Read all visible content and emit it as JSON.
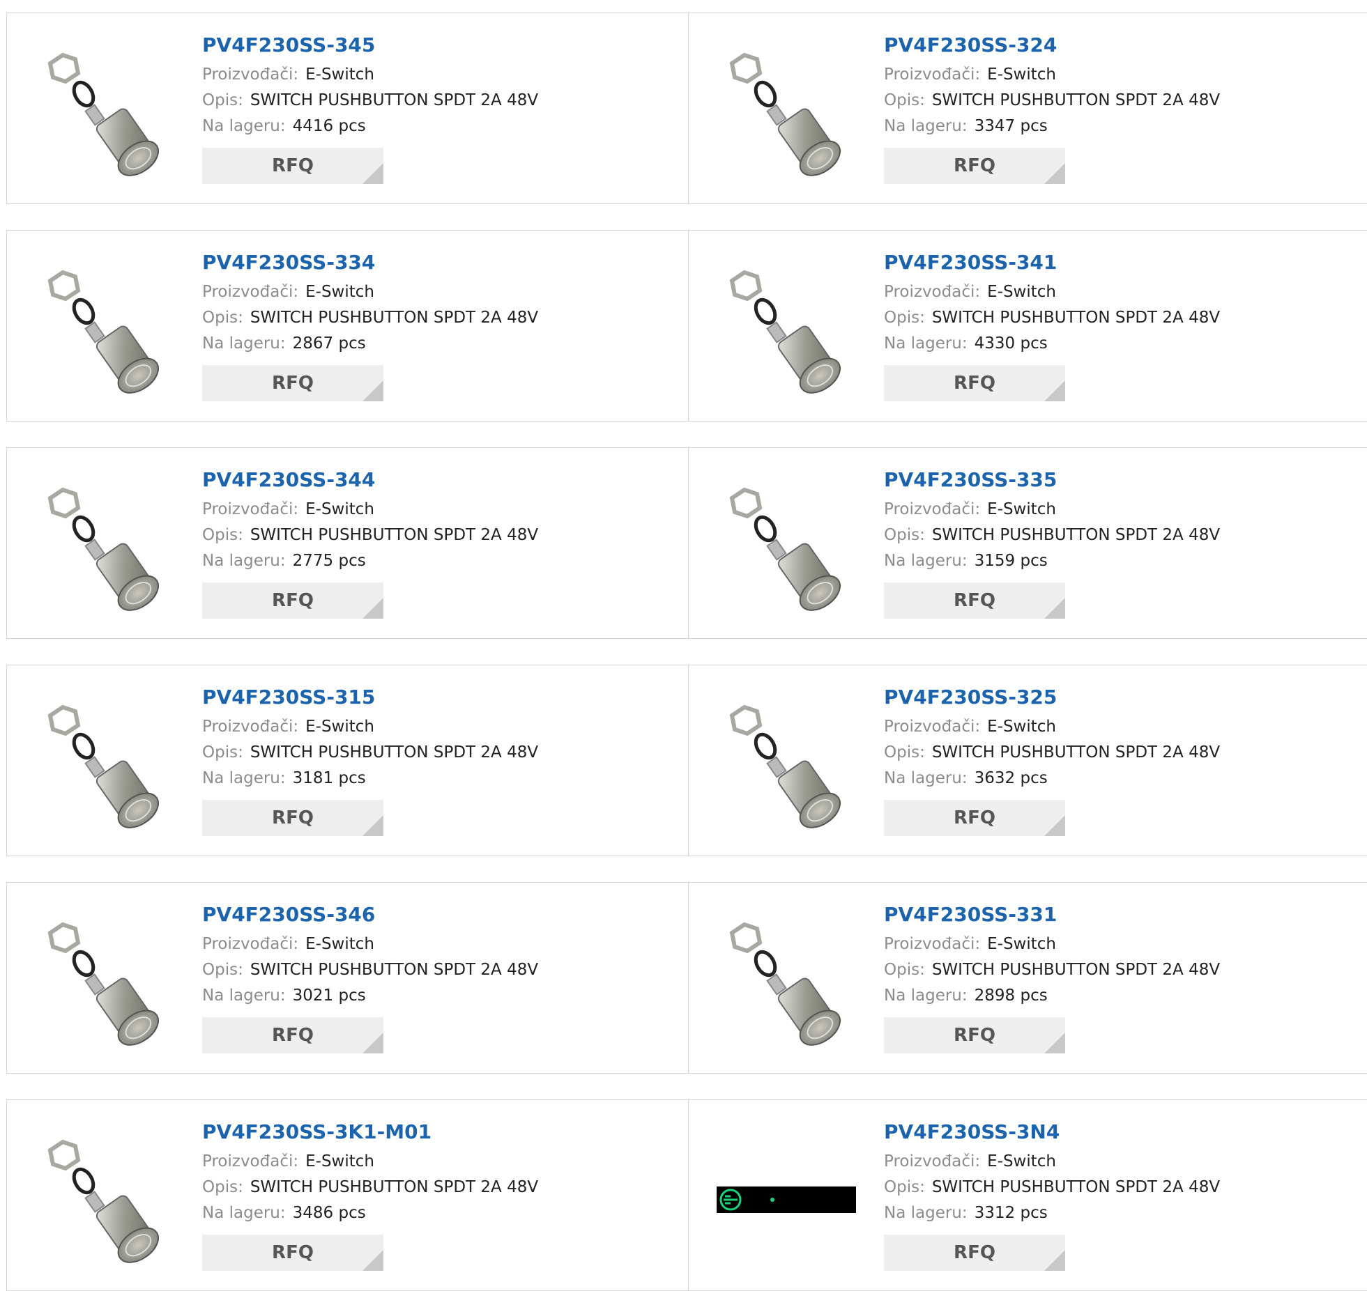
{
  "labels": {
    "manufacturer": "Proizvođači:",
    "description": "Opis:",
    "stock": "Na lageru:",
    "rfq": "RFQ"
  },
  "products": [
    {
      "part": "PV4F230SS-345",
      "manufacturer": "E-Switch",
      "description": "SWITCH PUSHBUTTON SPDT 2A 48V",
      "stock": "4416 pcs",
      "image": "pushbutton-switch-image"
    },
    {
      "part": "PV4F230SS-324",
      "manufacturer": "E-Switch",
      "description": "SWITCH PUSHBUTTON SPDT 2A 48V",
      "stock": "3347 pcs",
      "image": "pushbutton-switch-image"
    },
    {
      "part": "PV4F230SS-334",
      "manufacturer": "E-Switch",
      "description": "SWITCH PUSHBUTTON SPDT 2A 48V",
      "stock": "2867 pcs",
      "image": "pushbutton-switch-image"
    },
    {
      "part": "PV4F230SS-341",
      "manufacturer": "E-Switch",
      "description": "SWITCH PUSHBUTTON SPDT 2A 48V",
      "stock": "4330 pcs",
      "image": "pushbutton-switch-image"
    },
    {
      "part": "PV4F230SS-344",
      "manufacturer": "E-Switch",
      "description": "SWITCH PUSHBUTTON SPDT 2A 48V",
      "stock": "2775 pcs",
      "image": "pushbutton-switch-image"
    },
    {
      "part": "PV4F230SS-335",
      "manufacturer": "E-Switch",
      "description": "SWITCH PUSHBUTTON SPDT 2A 48V",
      "stock": "3159 pcs",
      "image": "pushbutton-switch-image"
    },
    {
      "part": "PV4F230SS-315",
      "manufacturer": "E-Switch",
      "description": "SWITCH PUSHBUTTON SPDT 2A 48V",
      "stock": "3181 pcs",
      "image": "pushbutton-switch-image"
    },
    {
      "part": "PV4F230SS-325",
      "manufacturer": "E-Switch",
      "description": "SWITCH PUSHBUTTON SPDT 2A 48V",
      "stock": "3632 pcs",
      "image": "pushbutton-switch-image"
    },
    {
      "part": "PV4F230SS-346",
      "manufacturer": "E-Switch",
      "description": "SWITCH PUSHBUTTON SPDT 2A 48V",
      "stock": "3021 pcs",
      "image": "pushbutton-switch-image"
    },
    {
      "part": "PV4F230SS-331",
      "manufacturer": "E-Switch",
      "description": "SWITCH PUSHBUTTON SPDT 2A 48V",
      "stock": "2898 pcs",
      "image": "pushbutton-switch-image"
    },
    {
      "part": "PV4F230SS-3K1-M01",
      "manufacturer": "E-Switch",
      "description": "SWITCH PUSHBUTTON SPDT 2A 48V",
      "stock": "3486 pcs",
      "image": "pushbutton-switch-image"
    },
    {
      "part": "PV4F230SS-3N4",
      "manufacturer": "E-Switch",
      "description": "SWITCH PUSHBUTTON SPDT 2A 48V",
      "stock": "3312 pcs",
      "image": "broken-image-placeholder"
    }
  ],
  "colors": {
    "link": "#1b64ad",
    "label": "#8c8c8c",
    "border": "#d4d4d4",
    "button_bg": "#eeeeee",
    "button_text": "#555555"
  }
}
